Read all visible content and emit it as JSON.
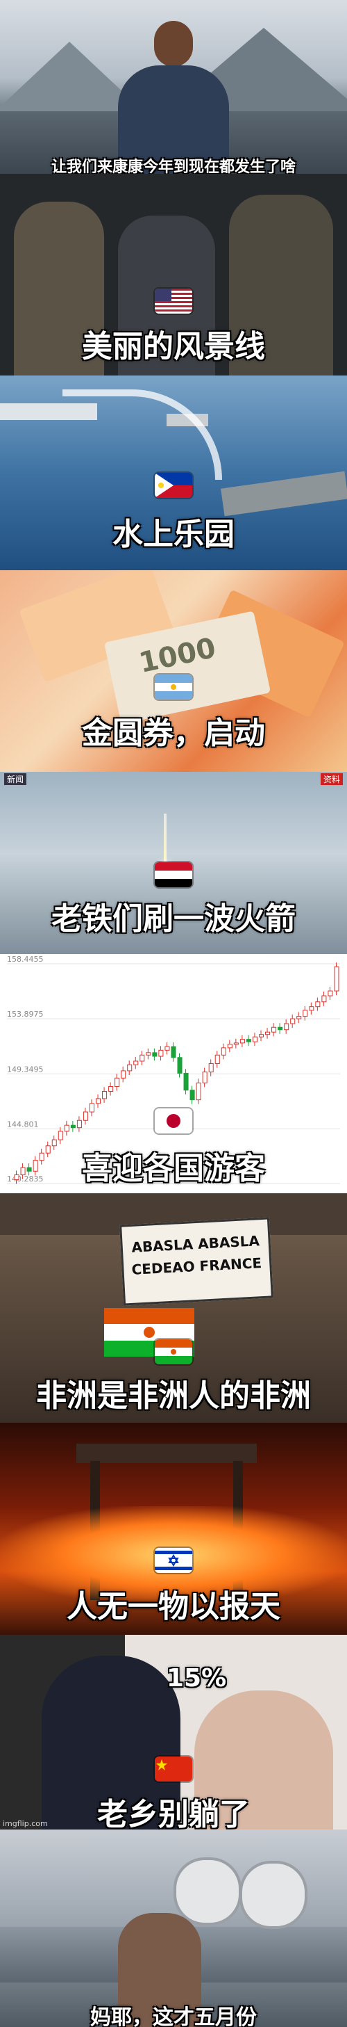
{
  "panels": [
    {
      "caption": "让我们来康康今年到现在都发生了啥"
    },
    {
      "caption": "美丽的风景线",
      "flag": "us-flag-icon"
    },
    {
      "caption": "水上乐园",
      "flag": "philippines-flag-icon"
    },
    {
      "caption": "金圆券，启动",
      "flag": "argentina-flag-icon",
      "banknote_text": "1000"
    },
    {
      "caption": "老铁们刷一波火箭",
      "flag": "yemen-flag-icon",
      "tv_label_left": "新闻",
      "tv_label_right": "资料"
    },
    {
      "caption": "喜迎各国游客",
      "flag": "japan-flag-icon"
    },
    {
      "caption": "非洲是非洲人的非洲",
      "flag": "niger-flag-icon",
      "sign_line1": "ABASLA  ABASLA",
      "sign_line2": "CEDEAO  FRANCE"
    },
    {
      "caption": "人无一物以报天",
      "flag": "israel-flag-icon"
    },
    {
      "caption": "老乡别躺了",
      "flag": "china-flag-icon",
      "percent": "15%",
      "watermark": "imgflip.com"
    },
    {
      "caption": "妈耶，这才五月份"
    }
  ],
  "chart_data": {
    "type": "candlestick",
    "yticks": [
      "158.4455",
      "153.8975",
      "149.3495",
      "144.801",
      "140.2835"
    ],
    "ylim": [
      140.2835,
      158.4455
    ],
    "grid": true,
    "closes": [
      141.0,
      141.6,
      141.3,
      142.2,
      142.8,
      143.4,
      143.9,
      144.6,
      145.1,
      144.9,
      145.5,
      146.2,
      146.9,
      147.3,
      147.9,
      148.3,
      149.0,
      149.6,
      150.1,
      150.4,
      150.9,
      151.1,
      150.8,
      151.3,
      151.6,
      150.7,
      149.4,
      148.0,
      147.2,
      148.6,
      149.5,
      150.2,
      150.9,
      151.5,
      151.8,
      151.9,
      152.2,
      152.0,
      152.4,
      152.6,
      152.8,
      153.2,
      153.0,
      153.5,
      153.9,
      154.1,
      154.6,
      154.9,
      155.3,
      155.8,
      156.2,
      158.2
    ]
  }
}
